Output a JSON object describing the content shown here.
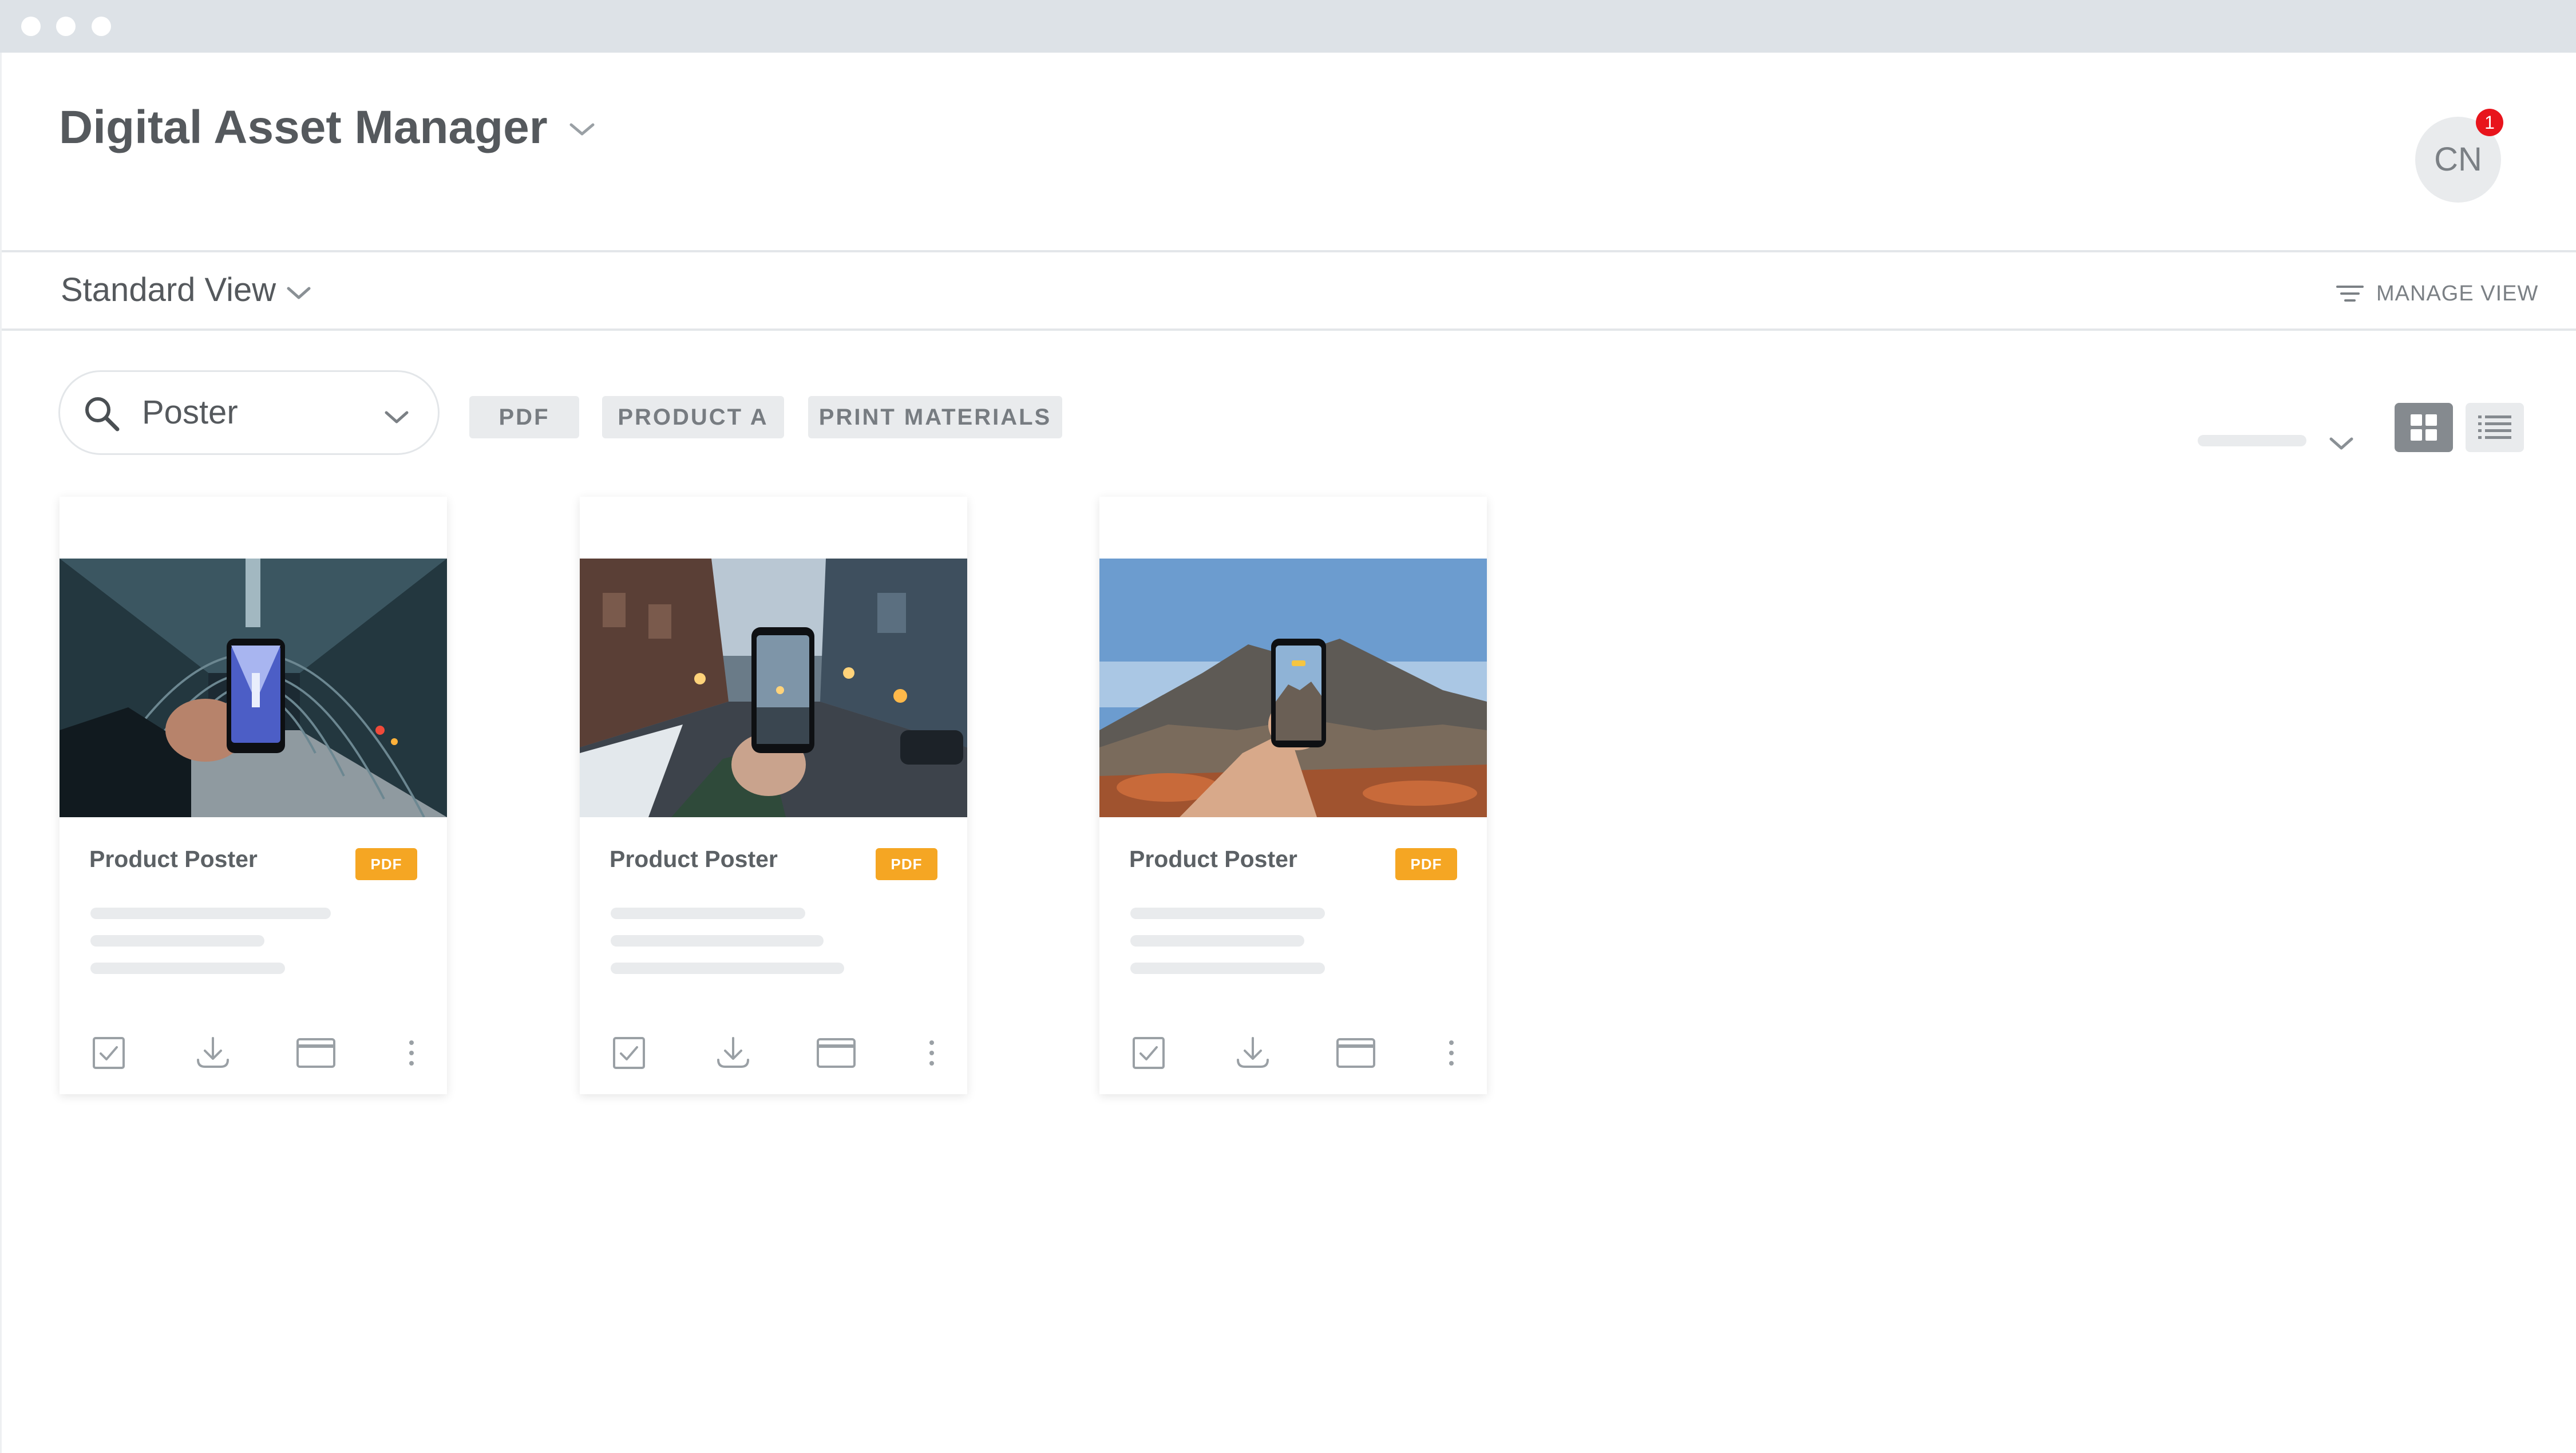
{
  "window": {
    "controls": [
      "close",
      "minimize",
      "maximize"
    ]
  },
  "header": {
    "app_title": "Digital Asset Manager",
    "user_initials": "CN",
    "notification_count": "1"
  },
  "view_bar": {
    "view_name": "Standard View",
    "manage_view_label": "MANAGE VIEW"
  },
  "filters": {
    "search_value": "Poster",
    "tags": [
      "PDF",
      "PRODUCT A",
      "PRINT MATERIALS"
    ]
  },
  "display": {
    "active_layout": "grid"
  },
  "icons": {
    "search": "search-icon",
    "chevron": "chevron-down-icon",
    "filter": "filter-lines-icon",
    "grid": "grid-view-icon",
    "list": "list-view-icon",
    "select": "checkbox-icon",
    "download": "download-icon",
    "preview": "window-icon",
    "more": "more-vertical-icon"
  },
  "colors": {
    "accent_badge": "#f5a623",
    "notification": "#e8141c",
    "text_primary": "#55595d",
    "chrome": "#dde2e7"
  },
  "assets": [
    {
      "title": "Product Poster",
      "format": "PDF",
      "image": "hand holding phone in glass tunnel"
    },
    {
      "title": "Product Poster",
      "format": "PDF",
      "image": "hand holding phone on city street"
    },
    {
      "title": "Product Poster",
      "format": "PDF",
      "image": "hand holding phone in desert mountains"
    }
  ]
}
